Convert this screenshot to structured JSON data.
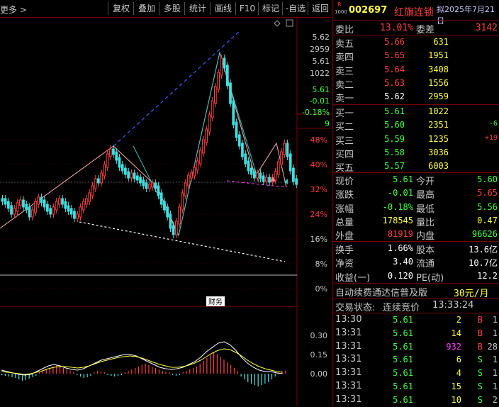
{
  "toolbar": {
    "more": "更多 >",
    "buttons": [
      "复权",
      "叠加",
      "多股",
      "统计",
      "画线",
      "F10",
      "标记",
      "-自选",
      "返回"
    ]
  },
  "chart": {
    "price_scale": [
      "5.62",
      "2959",
      "5.61",
      "1022",
      "5.61",
      "-0.01",
      "-0.18%",
      "9"
    ],
    "pct_scale": [
      "48%",
      "40%",
      "32%",
      "24%",
      "16%",
      "8%",
      "0%"
    ],
    "macd_scale": [
      "0.30",
      "0.15",
      "0.00"
    ],
    "badge": "财务",
    "colors": {
      "up": "#ff4040",
      "down": "#40e0e0",
      "ma_pink": "#ffb0b0",
      "dash_blue": "#4060ff",
      "white_dash": "#ffffff",
      "macd_yellow": "#ffff40"
    }
  },
  "quote": {
    "logo_top": "R",
    "logo_bottom": "1000",
    "code": "002697",
    "name": "红旗连锁",
    "date": "拟2025年7月21日",
    "wb_label": "委比",
    "wb_value": "13.01%",
    "wc_label": "委差",
    "wc_value": "3142",
    "sell": [
      {
        "label": "卖五",
        "price": "5.66",
        "vol": "631"
      },
      {
        "label": "卖四",
        "price": "5.65",
        "vol": "1951"
      },
      {
        "label": "卖三",
        "price": "5.64",
        "vol": "3408"
      },
      {
        "label": "卖二",
        "price": "5.63",
        "vol": "1556"
      },
      {
        "label": "卖一",
        "price": "5.62",
        "vol": "2959"
      }
    ],
    "buy": [
      {
        "label": "买一",
        "price": "5.61",
        "vol": "1022",
        "chg": ""
      },
      {
        "label": "买二",
        "price": "5.60",
        "vol": "2351",
        "chg": "-6"
      },
      {
        "label": "买三",
        "price": "5.59",
        "vol": "1235",
        "chg": "+19"
      },
      {
        "label": "买四",
        "price": "5.58",
        "vol": "3036",
        "chg": ""
      },
      {
        "label": "买五",
        "price": "5.57",
        "vol": "6003",
        "chg": ""
      }
    ],
    "stats": [
      {
        "l1": "现价",
        "v1": "5.61",
        "l2": "今开",
        "v2": "5.60"
      },
      {
        "l1": "涨跌",
        "v1": "-0.01",
        "l2": "最高",
        "v2": "5.65"
      },
      {
        "l1": "涨幅",
        "v1": "-0.18%",
        "l2": "最低",
        "v2": "5.56"
      },
      {
        "l1": "总量",
        "v1": "178545",
        "l2": "量比",
        "v2": "0.47"
      },
      {
        "l1": "外盘",
        "v1": "81919",
        "l2": "内盘",
        "v2": "96626"
      }
    ],
    "fin": [
      {
        "l1": "换手",
        "v1": "1.66%",
        "l2": "股本",
        "v2": "13.6亿"
      },
      {
        "l1": "净资",
        "v1": "3.40",
        "l2": "流通",
        "v2": "10.7亿"
      },
      {
        "l1": "收益(一)",
        "v1": "0.120",
        "l2": "PE(动)",
        "v2": "12.2"
      }
    ],
    "promo": "自动续费通达信普及版",
    "promo_price": "30元/月",
    "status_label": "交易状态:",
    "status_value": "连续竞价",
    "status_time": "13:33:24",
    "ticks": [
      {
        "t": "13:30",
        "p": "5.61",
        "v": "2",
        "s": "B",
        "n": "1"
      },
      {
        "t": "13:31",
        "p": "5.61",
        "v": "14",
        "s": "B",
        "n": "1"
      },
      {
        "t": "13:31",
        "p": "5.61",
        "v": "932",
        "s": "B",
        "n": "28"
      },
      {
        "t": "13:31",
        "p": "5.61",
        "v": "6",
        "s": "S",
        "n": "1"
      },
      {
        "t": "13:31",
        "p": "5.61",
        "v": "4",
        "s": "S",
        "n": "1"
      },
      {
        "t": "13:31",
        "p": "5.61",
        "v": "15",
        "s": "S",
        "n": "1"
      },
      {
        "t": "13:31",
        "p": "5.61",
        "v": "10",
        "s": "S",
        "n": "2"
      }
    ]
  }
}
